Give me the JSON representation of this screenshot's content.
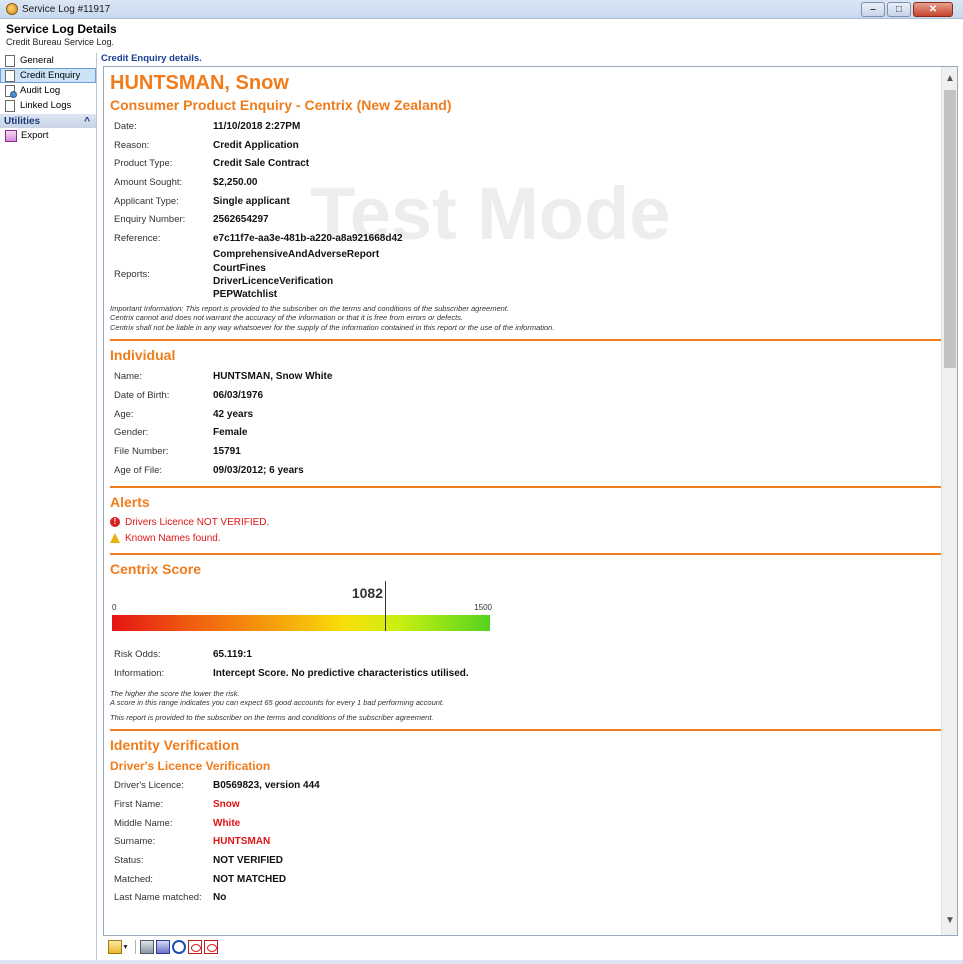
{
  "window": {
    "title": "Service Log #11917",
    "header_title": "Service Log Details",
    "header_subtitle": "Credit Bureau Service Log."
  },
  "sidebar": {
    "items": [
      {
        "label": "General",
        "active": false
      },
      {
        "label": "Credit Enquiry",
        "active": true
      },
      {
        "label": "Audit Log",
        "active": false
      },
      {
        "label": "Linked Logs",
        "active": false
      }
    ],
    "utilities_label": "Utilities",
    "utilities_items": [
      {
        "label": "Export"
      }
    ]
  },
  "content": {
    "heading": "Credit Enquiry details.",
    "watermark": "Test Mode",
    "name": "HUNTSMAN, Snow",
    "enquiry_title": "Consumer Product Enquiry - Centrix (New Zealand)",
    "details": [
      {
        "label": "Date:",
        "value": "11/10/2018 2:27PM"
      },
      {
        "label": "Reason:",
        "value": "Credit Application"
      },
      {
        "label": "Product Type:",
        "value": "Credit Sale Contract"
      },
      {
        "label": "Amount Sought:",
        "value": "$2,250.00"
      },
      {
        "label": "Applicant Type:",
        "value": "Single applicant"
      },
      {
        "label": "Enquiry Number:",
        "value": "2562654297"
      },
      {
        "label": "Reference:",
        "value": "e7c11f7e-aa3e-481b-a220-a8a921668d42"
      }
    ],
    "reports_label": "Reports:",
    "reports": [
      "ComprehensiveAndAdverseReport",
      "CourtFines",
      "DriverLicenceVerification",
      "PEPWatchlist"
    ],
    "disclaimer": [
      "Important Information: This report is provided to the subscriber on the terms and conditions of the subscriber agreement.",
      "Centrix cannot and does not warrant the accuracy of the information or that it is free from errors or defects.",
      "Centrix shall not be liable in any way whatsoever for the supply of the information contained in this report or the use of the information."
    ],
    "individual": {
      "title": "Individual",
      "rows": [
        {
          "label": "Name:",
          "value": "HUNTSMAN, Snow White"
        },
        {
          "label": "Date of Birth:",
          "value": "06/03/1976"
        },
        {
          "label": "Age:",
          "value": "42 years"
        },
        {
          "label": "Gender:",
          "value": "Female"
        },
        {
          "label": "File Number:",
          "value": "15791"
        },
        {
          "label": "Age of File:",
          "value": "09/03/2012; 6 years"
        }
      ]
    },
    "alerts": {
      "title": "Alerts",
      "items": [
        "Drivers Licence NOT VERIFIED.",
        "Known Names found."
      ]
    },
    "score": {
      "title": "Centrix Score",
      "value": 1082,
      "value_label": "1082",
      "min_label": "0",
      "max_label": "1500",
      "min": 0,
      "max": 1500,
      "rows": [
        {
          "label": "Risk Odds:",
          "value": "65.119:1"
        },
        {
          "label": "Information:",
          "value": "Intercept Score. No predictive characteristics utilised."
        }
      ],
      "note1": "The higher the score the lower the risk.",
      "note2": "A score in this range indicates you can expect 65 good accounts for every 1 bad performing account.",
      "note3": "This report is provided to the subscriber on the terms and conditions of the subscriber agreement."
    },
    "identity": {
      "title": "Identity Verification",
      "subtitle": "Driver's Licence Verification",
      "rows": [
        {
          "label": "Driver's Licence:",
          "value": "B0569823, version 444",
          "red": false
        },
        {
          "label": "First Name:",
          "value": "Snow",
          "red": true
        },
        {
          "label": "Middle Name:",
          "value": "White",
          "red": true
        },
        {
          "label": "Surname:",
          "value": "HUNTSMAN",
          "red": true
        },
        {
          "label": "Status:",
          "value": "NOT VERIFIED",
          "red": false
        },
        {
          "label": "Matched:",
          "value": "NOT MATCHED",
          "red": false
        },
        {
          "label": "Last Name matched:",
          "value": "No",
          "red": false
        }
      ]
    }
  },
  "icons": {
    "scroll_up": "▲",
    "scroll_down": "▼",
    "collapse": "^"
  }
}
